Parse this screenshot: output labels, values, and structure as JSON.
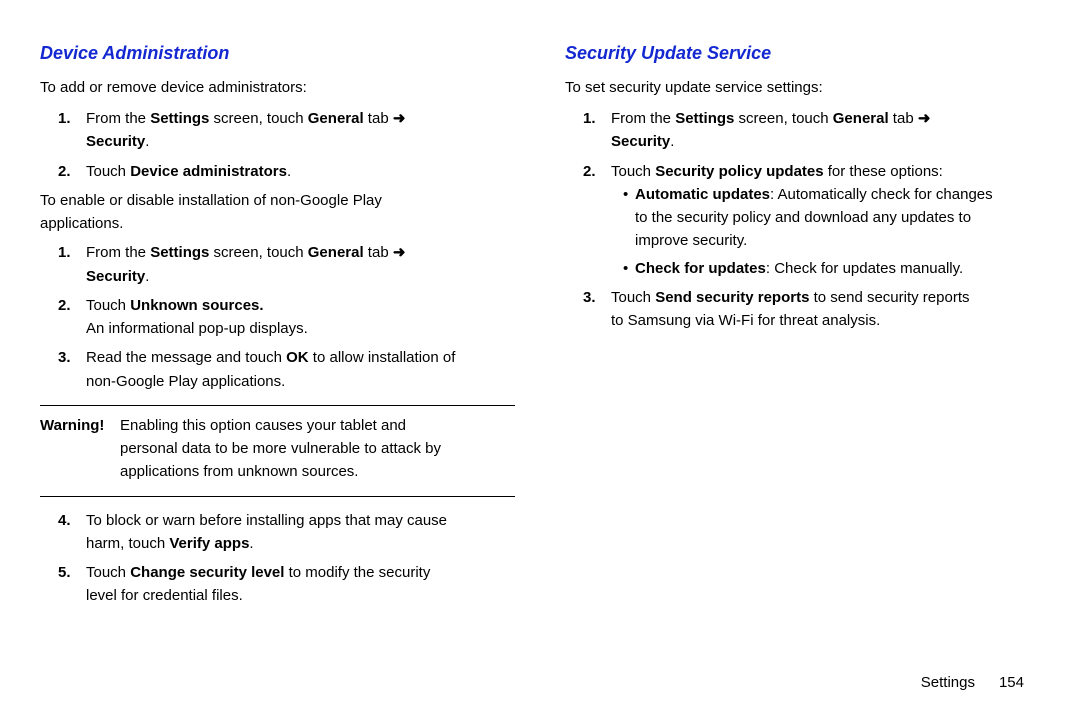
{
  "left": {
    "heading": "Device Administration",
    "intro1": "To add or remove device administrators:",
    "step1_prefix": "From the ",
    "step1_bold1": "Settings",
    "step1_mid1": " screen, touch ",
    "step1_bold2": "General",
    "step1_mid2": " tab ",
    "step1_arrow": "➜",
    "step1_bold3": "Security",
    "step1_suffix": ".",
    "step2_prefix": "Touch ",
    "step2_bold": "Device administrators",
    "step2_suffix": ".",
    "intro2_line1": "To enable or disable installation of non-Google Play",
    "intro2_line2": "applications.",
    "step2b_prefix": "Touch ",
    "step2b_bold": "Unknown sources.",
    "step2b_line2": "An informational pop-up displays.",
    "step3_prefix": "Read the message and touch ",
    "step3_bold": "OK",
    "step3_mid": " to allow installation of",
    "step3_line2": "non-Google Play applications.",
    "warn_label": "Warning!",
    "warn_text1": " Enabling this option causes your tablet and",
    "warn_line2": "personal data to be more vulnerable to attack by",
    "warn_line3": "applications from unknown sources.",
    "step4_line1": "To block or warn before installing apps that may cause",
    "step4_prefix2": "harm, touch ",
    "step4_bold": "Verify apps",
    "step4_suffix": ".",
    "step5_prefix": "Touch ",
    "step5_bold": "Change security level",
    "step5_mid": " to modify the security",
    "step5_line2": "level for credential files."
  },
  "right": {
    "heading": "Security Update Service",
    "intro": "To set security update service settings:",
    "step1_prefix": "From the ",
    "step1_bold1": "Settings",
    "step1_mid1": " screen, touch ",
    "step1_bold2": "General",
    "step1_mid2": " tab ",
    "step1_arrow": "➜",
    "step1_bold3": "Security",
    "step1_suffix": ".",
    "step2_prefix": "Touch ",
    "step2_bold": "Security policy updates",
    "step2_suffix": " for these options:",
    "bullet1_bold": "Automatic updates",
    "bullet1_text1": ": Automatically check for changes",
    "bullet1_line2": "to the security policy and download any updates to",
    "bullet1_line3": "improve security.",
    "bullet2_bold": "Check for updates",
    "bullet2_text": ": Check for updates manually.",
    "step3_prefix": "Touch ",
    "step3_bold": "Send security reports",
    "step3_mid": " to send security reports",
    "step3_line2": "to Samsung via Wi-Fi for threat analysis."
  },
  "footer": {
    "section": "Settings",
    "page": "154"
  }
}
